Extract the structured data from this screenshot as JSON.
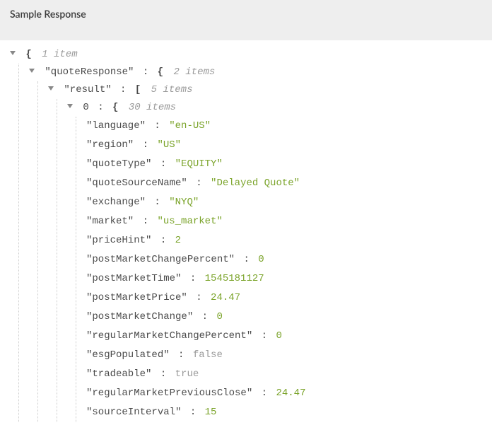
{
  "header": {
    "title": "Sample Response"
  },
  "tree": {
    "rootCount": "1 item",
    "quoteResponseKey": "\"quoteResponse\"",
    "quoteResponseCount": "2 items",
    "resultKey": "\"result\"",
    "resultCount": "5 items",
    "idx0": "0",
    "idx0Count": "30 items",
    "rows": [
      {
        "key": "\"language\"",
        "val": "\"en-US\"",
        "type": "str"
      },
      {
        "key": "\"region\"",
        "val": "\"US\"",
        "type": "str"
      },
      {
        "key": "\"quoteType\"",
        "val": "\"EQUITY\"",
        "type": "str"
      },
      {
        "key": "\"quoteSourceName\"",
        "val": "\"Delayed Quote\"",
        "type": "str"
      },
      {
        "key": "\"exchange\"",
        "val": "\"NYQ\"",
        "type": "str"
      },
      {
        "key": "\"market\"",
        "val": "\"us_market\"",
        "type": "str"
      },
      {
        "key": "\"priceHint\"",
        "val": "2",
        "type": "num"
      },
      {
        "key": "\"postMarketChangePercent\"",
        "val": "0",
        "type": "num"
      },
      {
        "key": "\"postMarketTime\"",
        "val": "1545181127",
        "type": "num"
      },
      {
        "key": "\"postMarketPrice\"",
        "val": "24.47",
        "type": "num"
      },
      {
        "key": "\"postMarketChange\"",
        "val": "0",
        "type": "num"
      },
      {
        "key": "\"regularMarketChangePercent\"",
        "val": "0",
        "type": "num"
      },
      {
        "key": "\"esgPopulated\"",
        "val": "false",
        "type": "bool"
      },
      {
        "key": "\"tradeable\"",
        "val": "true",
        "type": "bool"
      },
      {
        "key": "\"regularMarketPreviousClose\"",
        "val": "24.47",
        "type": "num"
      },
      {
        "key": "\"sourceInterval\"",
        "val": "15",
        "type": "num"
      }
    ]
  }
}
